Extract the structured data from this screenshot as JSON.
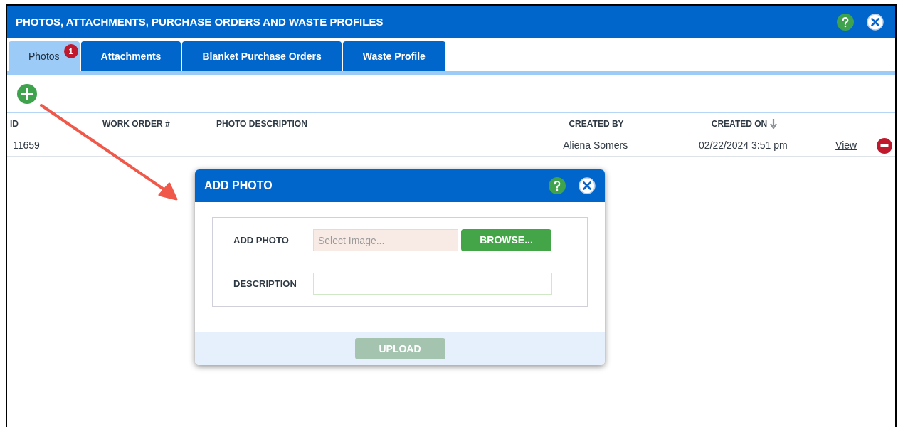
{
  "window": {
    "title": "PHOTOS, ATTACHMENTS, PURCHASE ORDERS AND WASTE PROFILES"
  },
  "tabs": [
    {
      "label": "Photos",
      "selected": true,
      "badge": "1"
    },
    {
      "label": "Attachments",
      "selected": false
    },
    {
      "label": "Blanket Purchase Orders",
      "selected": false
    },
    {
      "label": "Waste Profile",
      "selected": false
    }
  ],
  "table": {
    "columns": [
      {
        "label": "ID",
        "sorted": false
      },
      {
        "label": "WORK ORDER #",
        "sorted": false
      },
      {
        "label": "PHOTO DESCRIPTION",
        "sorted": false
      },
      {
        "label": "CREATED BY",
        "sorted": false
      },
      {
        "label": "CREATED ON",
        "sorted": true
      }
    ],
    "rows": [
      {
        "id": "11659",
        "created_by": "Aliena Somers",
        "created_on": "02/22/2024 3:51 pm",
        "action": "View"
      }
    ]
  },
  "dialog": {
    "title": "ADD PHOTO",
    "fields": [
      {
        "kind": "file",
        "label": "ADD PHOTO",
        "placeholder": "Select Image...",
        "button": "BROWSE..."
      },
      {
        "kind": "text",
        "label": "DESCRIPTION"
      }
    ],
    "submit": {
      "label": "UPLOAD",
      "disabled": true
    }
  }
}
